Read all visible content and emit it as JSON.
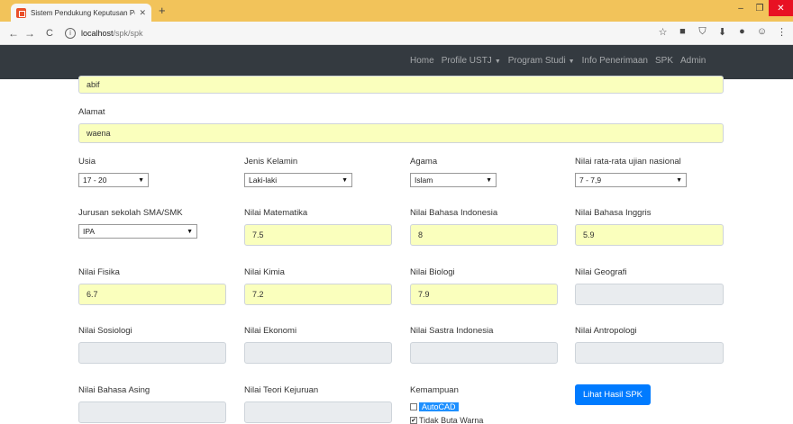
{
  "browser": {
    "tab_title": "Sistem Pendukung Keputusan Pe",
    "url_host": "localhost",
    "url_path": "/spk/spk"
  },
  "navbar": {
    "items": [
      "Home",
      "Profile USTJ",
      "Program Studi",
      "Info Penerimaan",
      "SPK",
      "Admin"
    ]
  },
  "form": {
    "nama_value": "abif",
    "alamat_label": "Alamat",
    "alamat_value": "waena",
    "usia_label": "Usia",
    "usia_value": "17 - 20",
    "jenis_kelamin_label": "Jenis Kelamin",
    "jenis_kelamin_value": "Laki-laki",
    "agama_label": "Agama",
    "agama_value": "Islam",
    "rata_rata_label": "Nilai rata-rata ujian nasional",
    "rata_rata_value": "7 - 7,9",
    "jurusan_label": "Jurusan sekolah SMA/SMK",
    "jurusan_value": "IPA",
    "matematika_label": "Nilai Matematika",
    "matematika_value": "7.5",
    "bindo_label": "Nilai Bahasa Indonesia",
    "bindo_value": "8",
    "binggris_label": "Nilai Bahasa Inggris",
    "binggris_value": "5.9",
    "fisika_label": "Nilai Fisika",
    "fisika_value": "6.7",
    "kimia_label": "Nilai Kimia",
    "kimia_value": "7.2",
    "biologi_label": "Nilai Biologi",
    "biologi_value": "7.9",
    "geografi_label": "Nilai Geografi",
    "sosiologi_label": "Nilai Sosiologi",
    "ekonomi_label": "Nilai Ekonomi",
    "sastra_label": "Nilai Sastra Indonesia",
    "antropologi_label": "Nilai Antropologi",
    "bahasa_asing_label": "Nilai Bahasa Asing",
    "teori_kejuruan_label": "Nilai Teori Kejuruan",
    "kemampuan_label": "Kemampuan",
    "kemampuan_options": [
      {
        "label": "AutoCAD",
        "checked": false
      },
      {
        "label": "Tidak Buta Warna",
        "checked": true
      }
    ],
    "submit_label": "Lihat Hasil SPK"
  },
  "colors": {
    "navbar_bg": "#343a40",
    "autofill_bg": "#faffbd",
    "disabled_bg": "#e9ecef",
    "primary": "#007bff",
    "tabstrip": "#f2c35a"
  }
}
